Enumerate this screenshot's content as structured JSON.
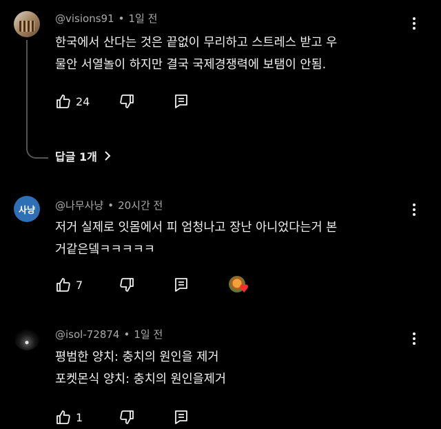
{
  "comments": [
    {
      "author": "@visions91",
      "time": "1일 전",
      "text_lines": [
        "한국에서 산다는 것은 끝없이 무리하고 스트레스 받고 우",
        "물안 서열놀이 하지만 결국 국제경쟁력에 보탬이 안됨."
      ],
      "likes": "24",
      "replies_label": "답글 1개"
    },
    {
      "author": "@나무사냥",
      "avatar_text": "사냥",
      "time": "20시간 전",
      "text_lines": [
        "저거 실제로 잇몸에서 피 엄청나고 장난 아니었다는거 본",
        "거같은뎈ㅋㅋㅋㅋㅋ"
      ],
      "likes": "7",
      "creator_heart": true
    },
    {
      "author": "@isol-72874",
      "time": "1일 전",
      "text_lines": [
        "평범한 양치: 충치의 원인을 제거",
        "포켓몬식 양치: 충치의 원인을제거"
      ],
      "likes": "1"
    }
  ],
  "separator": "•",
  "icons": {
    "like": "thumbs-up-icon",
    "dislike": "thumbs-down-icon",
    "reply": "comment-reply-icon",
    "more": "more-vert-icon",
    "expand": "chevron-right-icon",
    "heart": "heart-icon"
  },
  "colors": {
    "background": "#000000",
    "text": "#f1f1f1",
    "meta": "#aaaaaa",
    "heart": "#ff2a2a",
    "avatar_blue": "#2f6fb5"
  }
}
